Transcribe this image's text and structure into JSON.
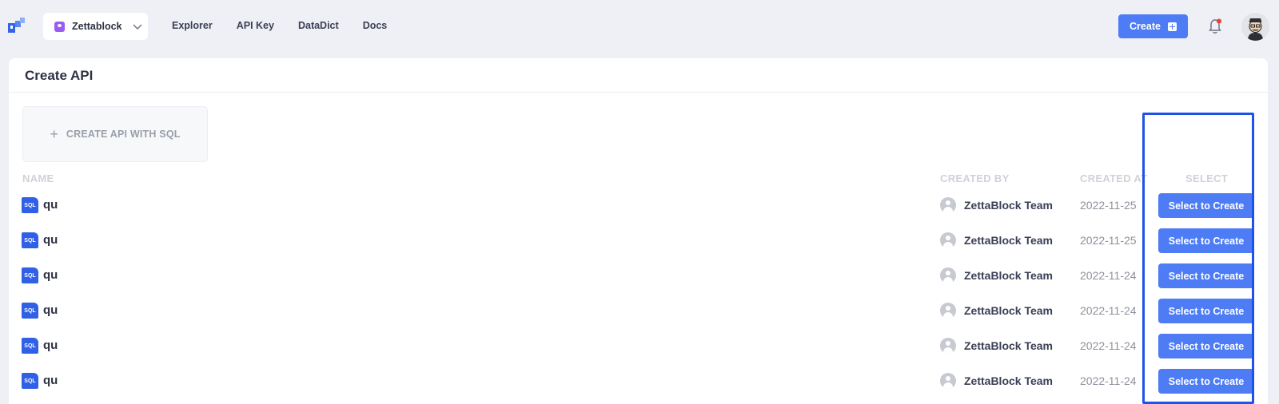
{
  "topbar": {
    "workspace_name": "Zettablock",
    "nav": [
      "Explorer",
      "API Key",
      "DataDict",
      "Docs"
    ],
    "create_label": "Create",
    "colors": {
      "accent": "#4d7cf5",
      "notification_dot": "#e8413a"
    }
  },
  "page": {
    "title": "Create API",
    "create_sql_label": "CREATE API WITH SQL"
  },
  "table": {
    "headers": {
      "name": "NAME",
      "created_by": "CREATED BY",
      "created_at": "CREATED AT",
      "select": "SELECT"
    },
    "rows": [
      {
        "icon_text": "SQL",
        "name": "qu",
        "created_by": "ZettaBlock Team",
        "created_at": "2022-11-25",
        "action": "Select to Create"
      },
      {
        "icon_text": "SQL",
        "name": "qu",
        "created_by": "ZettaBlock Team",
        "created_at": "2022-11-25",
        "action": "Select to Create"
      },
      {
        "icon_text": "SQL",
        "name": "qu",
        "created_by": "ZettaBlock Team",
        "created_at": "2022-11-24",
        "action": "Select to Create"
      },
      {
        "icon_text": "SQL",
        "name": "qu",
        "created_by": "ZettaBlock Team",
        "created_at": "2022-11-24",
        "action": "Select to Create"
      },
      {
        "icon_text": "SQL",
        "name": "qu",
        "created_by": "ZettaBlock Team",
        "created_at": "2022-11-24",
        "action": "Select to Create"
      },
      {
        "icon_text": "SQL",
        "name": "qu",
        "created_by": "ZettaBlock Team",
        "created_at": "2022-11-24",
        "action": "Select to Create"
      }
    ]
  }
}
